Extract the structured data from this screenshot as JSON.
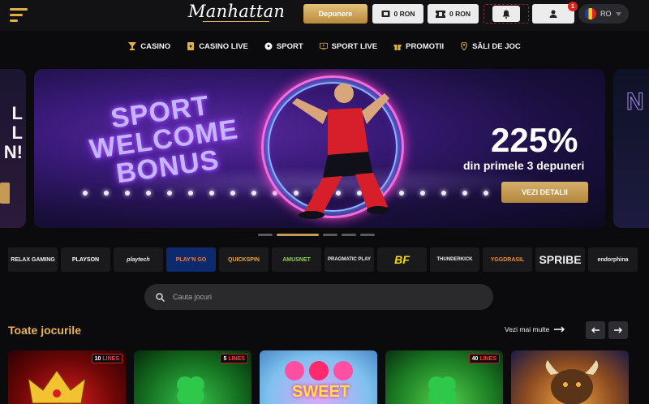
{
  "header": {
    "logo_text": "Manhattan",
    "deposit_label": "Depunere",
    "balance_label": "0 RON",
    "bonus_label": "0 RON",
    "notification_count": "1",
    "language": "RO"
  },
  "nav": {
    "items": [
      {
        "label": "CASINO",
        "icon": "cocktail-icon"
      },
      {
        "label": "CASINO LIVE",
        "icon": "cards-icon"
      },
      {
        "label": "SPORT",
        "icon": "soccer-ball-icon"
      },
      {
        "label": "SPORT LIVE",
        "icon": "tv-icon"
      },
      {
        "label": "PROMOTII",
        "icon": "gift-icon"
      },
      {
        "label": "SĂLI DE JOC",
        "icon": "location-pin-icon"
      }
    ]
  },
  "banner": {
    "headline": [
      "SPORT",
      "WELCOME",
      "BONUS"
    ],
    "percent": "225%",
    "subtitle": "din primele 3 depuneri",
    "cta_label": "VEZI DETALII",
    "left_peek": [
      "L",
      "L",
      "N!"
    ],
    "right_peek": "N"
  },
  "carousel": {
    "slides": 5,
    "active_index": 1
  },
  "providers": [
    "RELAX GAMING",
    "PLAYSON",
    "playtech",
    "PLAY'N GO",
    "QUICKSPIN",
    "AMUSNET",
    "PRAGMATIC PLAY",
    "BF",
    "THUNDERKICK",
    "YGGDRASIL",
    "SPRIBE",
    "endorphina"
  ],
  "search": {
    "placeholder": "Cauta jocuri"
  },
  "games_section": {
    "title": "Toate jocurile",
    "see_more": "Vezi mai multe",
    "games": [
      {
        "lines": "10",
        "lines_label": "LINES",
        "title": ""
      },
      {
        "lines": "5",
        "lines_label": "LINES",
        "title": ""
      },
      {
        "lines": "",
        "lines_label": "",
        "title": "SWEET"
      },
      {
        "lines": "40",
        "lines_label": "LINES",
        "title": ""
      },
      {
        "lines": "",
        "lines_label": "",
        "title": ""
      }
    ]
  },
  "colors": {
    "accent": "#e2b04a",
    "background": "#0b0b0d",
    "badge": "#d9261c"
  }
}
